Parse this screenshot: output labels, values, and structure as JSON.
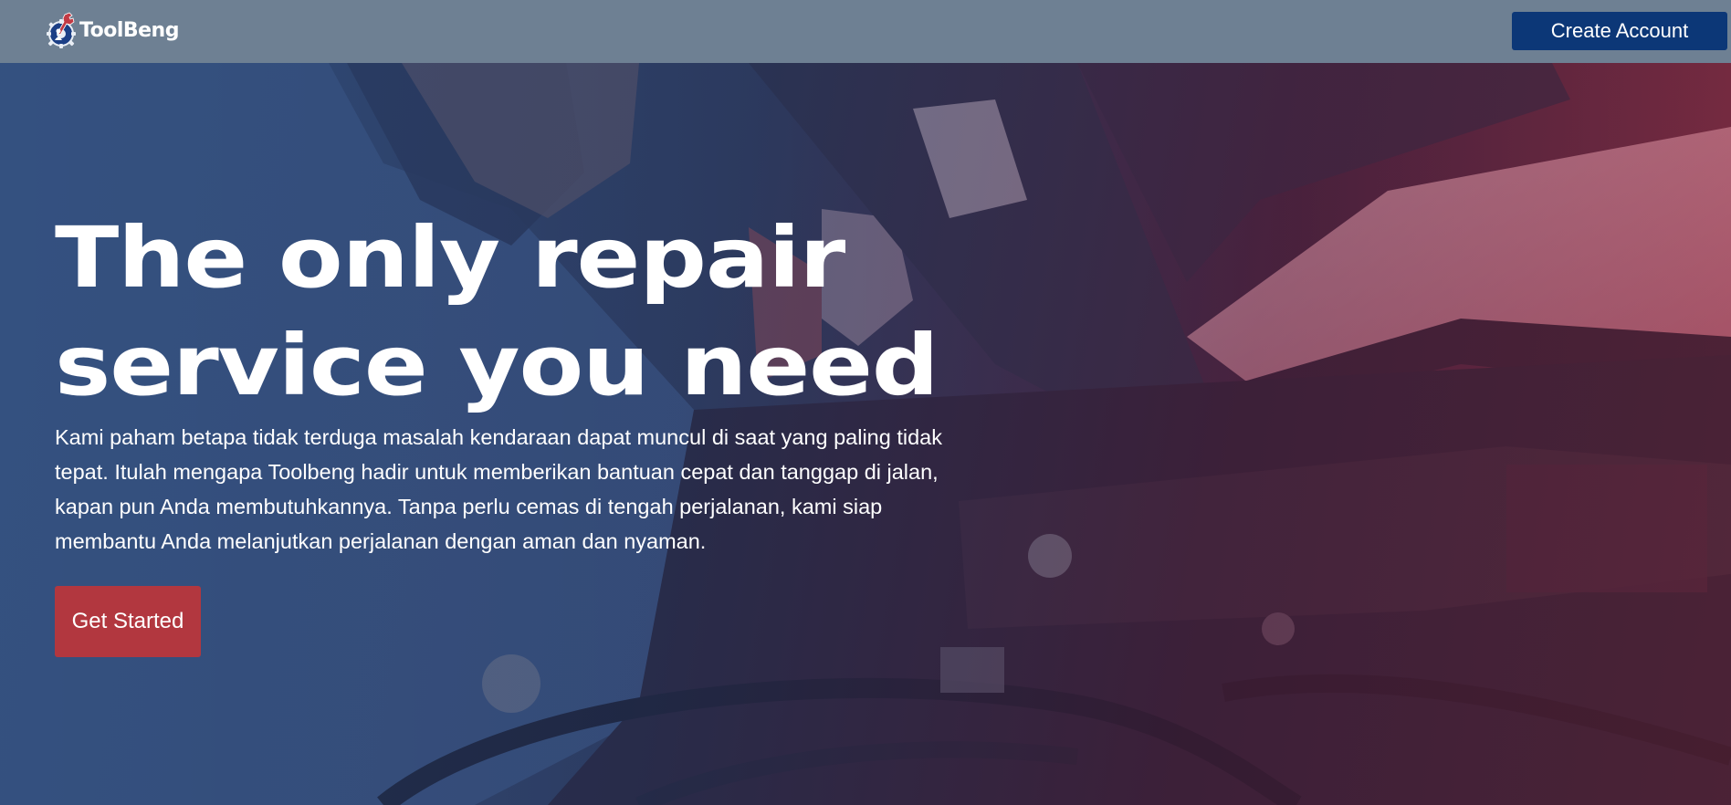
{
  "navbar": {
    "brand_name": "ToolBeng",
    "create_account_label": "Create Account",
    "background_color": "#6e8093",
    "button_color": "#0c3777"
  },
  "hero": {
    "title": "The only repair service you need",
    "description": "Kami paham betapa tidak terduga masalah kendaraan dapat muncul di saat yang paling tidak tepat. Itulah mengapa Toolbeng hadir untuk memberikan bantuan cepat dan tanggap di jalan, kapan pun Anda membutuhkannya. Tanpa perlu cemas di tengah perjalanan, kami siap membantu Anda melanjutkan perjalanan dengan aman dan nyaman.",
    "cta_label": "Get Started",
    "cta_color": "#b2373f",
    "background_image": "mechanic-repairing-car-engine-photo"
  },
  "icons": {
    "logo": "gear-wrench-logo-icon"
  }
}
